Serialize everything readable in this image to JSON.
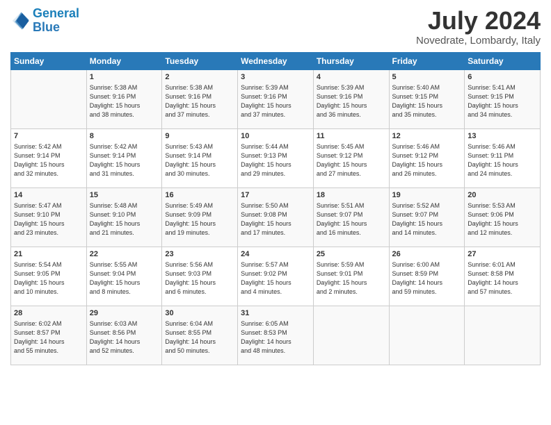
{
  "header": {
    "logo_line1": "General",
    "logo_line2": "Blue",
    "month_year": "July 2024",
    "location": "Novedrate, Lombardy, Italy"
  },
  "weekdays": [
    "Sunday",
    "Monday",
    "Tuesday",
    "Wednesday",
    "Thursday",
    "Friday",
    "Saturday"
  ],
  "weeks": [
    [
      {
        "day": "",
        "info": ""
      },
      {
        "day": "1",
        "info": "Sunrise: 5:38 AM\nSunset: 9:16 PM\nDaylight: 15 hours\nand 38 minutes."
      },
      {
        "day": "2",
        "info": "Sunrise: 5:38 AM\nSunset: 9:16 PM\nDaylight: 15 hours\nand 37 minutes."
      },
      {
        "day": "3",
        "info": "Sunrise: 5:39 AM\nSunset: 9:16 PM\nDaylight: 15 hours\nand 37 minutes."
      },
      {
        "day": "4",
        "info": "Sunrise: 5:39 AM\nSunset: 9:16 PM\nDaylight: 15 hours\nand 36 minutes."
      },
      {
        "day": "5",
        "info": "Sunrise: 5:40 AM\nSunset: 9:15 PM\nDaylight: 15 hours\nand 35 minutes."
      },
      {
        "day": "6",
        "info": "Sunrise: 5:41 AM\nSunset: 9:15 PM\nDaylight: 15 hours\nand 34 minutes."
      }
    ],
    [
      {
        "day": "7",
        "info": "Sunrise: 5:42 AM\nSunset: 9:14 PM\nDaylight: 15 hours\nand 32 minutes."
      },
      {
        "day": "8",
        "info": "Sunrise: 5:42 AM\nSunset: 9:14 PM\nDaylight: 15 hours\nand 31 minutes."
      },
      {
        "day": "9",
        "info": "Sunrise: 5:43 AM\nSunset: 9:14 PM\nDaylight: 15 hours\nand 30 minutes."
      },
      {
        "day": "10",
        "info": "Sunrise: 5:44 AM\nSunset: 9:13 PM\nDaylight: 15 hours\nand 29 minutes."
      },
      {
        "day": "11",
        "info": "Sunrise: 5:45 AM\nSunset: 9:12 PM\nDaylight: 15 hours\nand 27 minutes."
      },
      {
        "day": "12",
        "info": "Sunrise: 5:46 AM\nSunset: 9:12 PM\nDaylight: 15 hours\nand 26 minutes."
      },
      {
        "day": "13",
        "info": "Sunrise: 5:46 AM\nSunset: 9:11 PM\nDaylight: 15 hours\nand 24 minutes."
      }
    ],
    [
      {
        "day": "14",
        "info": "Sunrise: 5:47 AM\nSunset: 9:10 PM\nDaylight: 15 hours\nand 23 minutes."
      },
      {
        "day": "15",
        "info": "Sunrise: 5:48 AM\nSunset: 9:10 PM\nDaylight: 15 hours\nand 21 minutes."
      },
      {
        "day": "16",
        "info": "Sunrise: 5:49 AM\nSunset: 9:09 PM\nDaylight: 15 hours\nand 19 minutes."
      },
      {
        "day": "17",
        "info": "Sunrise: 5:50 AM\nSunset: 9:08 PM\nDaylight: 15 hours\nand 17 minutes."
      },
      {
        "day": "18",
        "info": "Sunrise: 5:51 AM\nSunset: 9:07 PM\nDaylight: 15 hours\nand 16 minutes."
      },
      {
        "day": "19",
        "info": "Sunrise: 5:52 AM\nSunset: 9:07 PM\nDaylight: 15 hours\nand 14 minutes."
      },
      {
        "day": "20",
        "info": "Sunrise: 5:53 AM\nSunset: 9:06 PM\nDaylight: 15 hours\nand 12 minutes."
      }
    ],
    [
      {
        "day": "21",
        "info": "Sunrise: 5:54 AM\nSunset: 9:05 PM\nDaylight: 15 hours\nand 10 minutes."
      },
      {
        "day": "22",
        "info": "Sunrise: 5:55 AM\nSunset: 9:04 PM\nDaylight: 15 hours\nand 8 minutes."
      },
      {
        "day": "23",
        "info": "Sunrise: 5:56 AM\nSunset: 9:03 PM\nDaylight: 15 hours\nand 6 minutes."
      },
      {
        "day": "24",
        "info": "Sunrise: 5:57 AM\nSunset: 9:02 PM\nDaylight: 15 hours\nand 4 minutes."
      },
      {
        "day": "25",
        "info": "Sunrise: 5:59 AM\nSunset: 9:01 PM\nDaylight: 15 hours\nand 2 minutes."
      },
      {
        "day": "26",
        "info": "Sunrise: 6:00 AM\nSunset: 8:59 PM\nDaylight: 14 hours\nand 59 minutes."
      },
      {
        "day": "27",
        "info": "Sunrise: 6:01 AM\nSunset: 8:58 PM\nDaylight: 14 hours\nand 57 minutes."
      }
    ],
    [
      {
        "day": "28",
        "info": "Sunrise: 6:02 AM\nSunset: 8:57 PM\nDaylight: 14 hours\nand 55 minutes."
      },
      {
        "day": "29",
        "info": "Sunrise: 6:03 AM\nSunset: 8:56 PM\nDaylight: 14 hours\nand 52 minutes."
      },
      {
        "day": "30",
        "info": "Sunrise: 6:04 AM\nSunset: 8:55 PM\nDaylight: 14 hours\nand 50 minutes."
      },
      {
        "day": "31",
        "info": "Sunrise: 6:05 AM\nSunset: 8:53 PM\nDaylight: 14 hours\nand 48 minutes."
      },
      {
        "day": "",
        "info": ""
      },
      {
        "day": "",
        "info": ""
      },
      {
        "day": "",
        "info": ""
      }
    ]
  ]
}
